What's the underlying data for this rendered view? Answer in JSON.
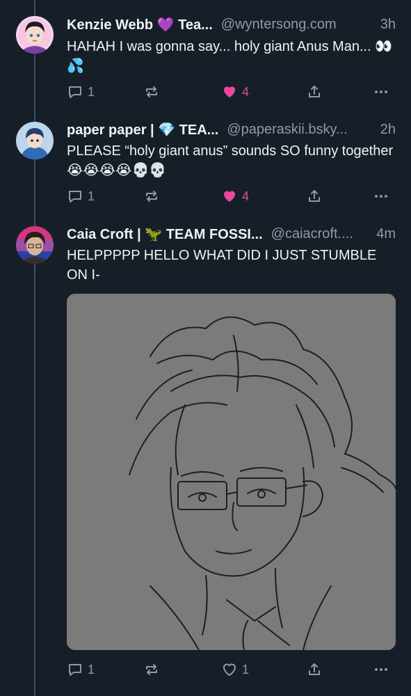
{
  "colors": {
    "background": "#161e27",
    "thread_line": "#3a4f6a",
    "muted_text": "#8c9bab",
    "like_active": "#ec4899",
    "image_bg": "#7b7b7b"
  },
  "posts": [
    {
      "name": "Kenzie Webb 💜 Tea...",
      "handle": "@wyntersong.com",
      "time": "3h",
      "text": "HAHAH I was gonna say... holy giant Anus Man... 👀💦",
      "reply_count": "1",
      "repost_count": "",
      "like_count": "4",
      "liked": true
    },
    {
      "name": "paper paper | 💎 TEA...",
      "handle": "@paperaskii.bsky...",
      "time": "2h",
      "text": "PLEASE “holy giant anus” sounds SO funny together 😭😭😭😭💀💀",
      "reply_count": "1",
      "repost_count": "",
      "like_count": "4",
      "liked": true
    },
    {
      "name": "Caia Croft | 🦖 TEAM FOSSI...",
      "handle": "@caiacroft....",
      "time": "4m",
      "text": "HELPPPPP HELLO WHAT DID I JUST STUMBLE ON I-",
      "reply_count": "1",
      "repost_count": "",
      "like_count": "1",
      "liked": false
    }
  ],
  "icons": {
    "reply": "speech-bubble-icon",
    "repost": "repost-arrows-icon",
    "like": "heart-icon",
    "share": "share-upload-icon",
    "more": "ellipsis-icon"
  }
}
